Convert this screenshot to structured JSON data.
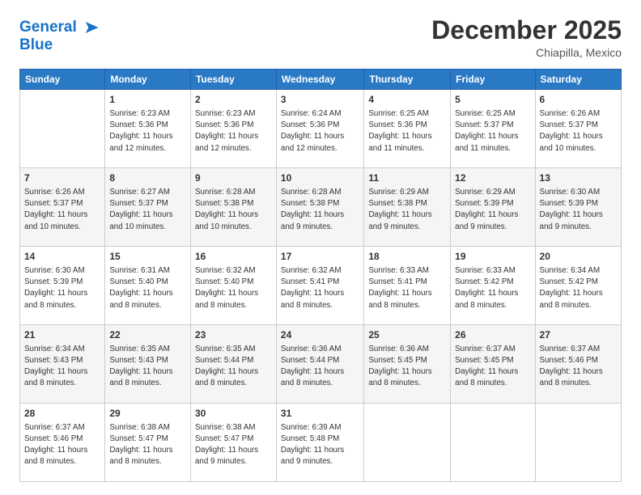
{
  "logo": {
    "line1": "General",
    "line2": "Blue"
  },
  "title": "December 2025",
  "subtitle": "Chiapilla, Mexico",
  "header_days": [
    "Sunday",
    "Monday",
    "Tuesday",
    "Wednesday",
    "Thursday",
    "Friday",
    "Saturday"
  ],
  "weeks": [
    [
      {
        "day": "",
        "info": ""
      },
      {
        "day": "1",
        "info": "Sunrise: 6:23 AM\nSunset: 5:36 PM\nDaylight: 11 hours\nand 12 minutes."
      },
      {
        "day": "2",
        "info": "Sunrise: 6:23 AM\nSunset: 5:36 PM\nDaylight: 11 hours\nand 12 minutes."
      },
      {
        "day": "3",
        "info": "Sunrise: 6:24 AM\nSunset: 5:36 PM\nDaylight: 11 hours\nand 12 minutes."
      },
      {
        "day": "4",
        "info": "Sunrise: 6:25 AM\nSunset: 5:36 PM\nDaylight: 11 hours\nand 11 minutes."
      },
      {
        "day": "5",
        "info": "Sunrise: 6:25 AM\nSunset: 5:37 PM\nDaylight: 11 hours\nand 11 minutes."
      },
      {
        "day": "6",
        "info": "Sunrise: 6:26 AM\nSunset: 5:37 PM\nDaylight: 11 hours\nand 10 minutes."
      }
    ],
    [
      {
        "day": "7",
        "info": "Sunrise: 6:26 AM\nSunset: 5:37 PM\nDaylight: 11 hours\nand 10 minutes."
      },
      {
        "day": "8",
        "info": "Sunrise: 6:27 AM\nSunset: 5:37 PM\nDaylight: 11 hours\nand 10 minutes."
      },
      {
        "day": "9",
        "info": "Sunrise: 6:28 AM\nSunset: 5:38 PM\nDaylight: 11 hours\nand 10 minutes."
      },
      {
        "day": "10",
        "info": "Sunrise: 6:28 AM\nSunset: 5:38 PM\nDaylight: 11 hours\nand 9 minutes."
      },
      {
        "day": "11",
        "info": "Sunrise: 6:29 AM\nSunset: 5:38 PM\nDaylight: 11 hours\nand 9 minutes."
      },
      {
        "day": "12",
        "info": "Sunrise: 6:29 AM\nSunset: 5:39 PM\nDaylight: 11 hours\nand 9 minutes."
      },
      {
        "day": "13",
        "info": "Sunrise: 6:30 AM\nSunset: 5:39 PM\nDaylight: 11 hours\nand 9 minutes."
      }
    ],
    [
      {
        "day": "14",
        "info": "Sunrise: 6:30 AM\nSunset: 5:39 PM\nDaylight: 11 hours\nand 8 minutes."
      },
      {
        "day": "15",
        "info": "Sunrise: 6:31 AM\nSunset: 5:40 PM\nDaylight: 11 hours\nand 8 minutes."
      },
      {
        "day": "16",
        "info": "Sunrise: 6:32 AM\nSunset: 5:40 PM\nDaylight: 11 hours\nand 8 minutes."
      },
      {
        "day": "17",
        "info": "Sunrise: 6:32 AM\nSunset: 5:41 PM\nDaylight: 11 hours\nand 8 minutes."
      },
      {
        "day": "18",
        "info": "Sunrise: 6:33 AM\nSunset: 5:41 PM\nDaylight: 11 hours\nand 8 minutes."
      },
      {
        "day": "19",
        "info": "Sunrise: 6:33 AM\nSunset: 5:42 PM\nDaylight: 11 hours\nand 8 minutes."
      },
      {
        "day": "20",
        "info": "Sunrise: 6:34 AM\nSunset: 5:42 PM\nDaylight: 11 hours\nand 8 minutes."
      }
    ],
    [
      {
        "day": "21",
        "info": "Sunrise: 6:34 AM\nSunset: 5:43 PM\nDaylight: 11 hours\nand 8 minutes."
      },
      {
        "day": "22",
        "info": "Sunrise: 6:35 AM\nSunset: 5:43 PM\nDaylight: 11 hours\nand 8 minutes."
      },
      {
        "day": "23",
        "info": "Sunrise: 6:35 AM\nSunset: 5:44 PM\nDaylight: 11 hours\nand 8 minutes."
      },
      {
        "day": "24",
        "info": "Sunrise: 6:36 AM\nSunset: 5:44 PM\nDaylight: 11 hours\nand 8 minutes."
      },
      {
        "day": "25",
        "info": "Sunrise: 6:36 AM\nSunset: 5:45 PM\nDaylight: 11 hours\nand 8 minutes."
      },
      {
        "day": "26",
        "info": "Sunrise: 6:37 AM\nSunset: 5:45 PM\nDaylight: 11 hours\nand 8 minutes."
      },
      {
        "day": "27",
        "info": "Sunrise: 6:37 AM\nSunset: 5:46 PM\nDaylight: 11 hours\nand 8 minutes."
      }
    ],
    [
      {
        "day": "28",
        "info": "Sunrise: 6:37 AM\nSunset: 5:46 PM\nDaylight: 11 hours\nand 8 minutes."
      },
      {
        "day": "29",
        "info": "Sunrise: 6:38 AM\nSunset: 5:47 PM\nDaylight: 11 hours\nand 8 minutes."
      },
      {
        "day": "30",
        "info": "Sunrise: 6:38 AM\nSunset: 5:47 PM\nDaylight: 11 hours\nand 9 minutes."
      },
      {
        "day": "31",
        "info": "Sunrise: 6:39 AM\nSunset: 5:48 PM\nDaylight: 11 hours\nand 9 minutes."
      },
      {
        "day": "",
        "info": ""
      },
      {
        "day": "",
        "info": ""
      },
      {
        "day": "",
        "info": ""
      }
    ]
  ]
}
